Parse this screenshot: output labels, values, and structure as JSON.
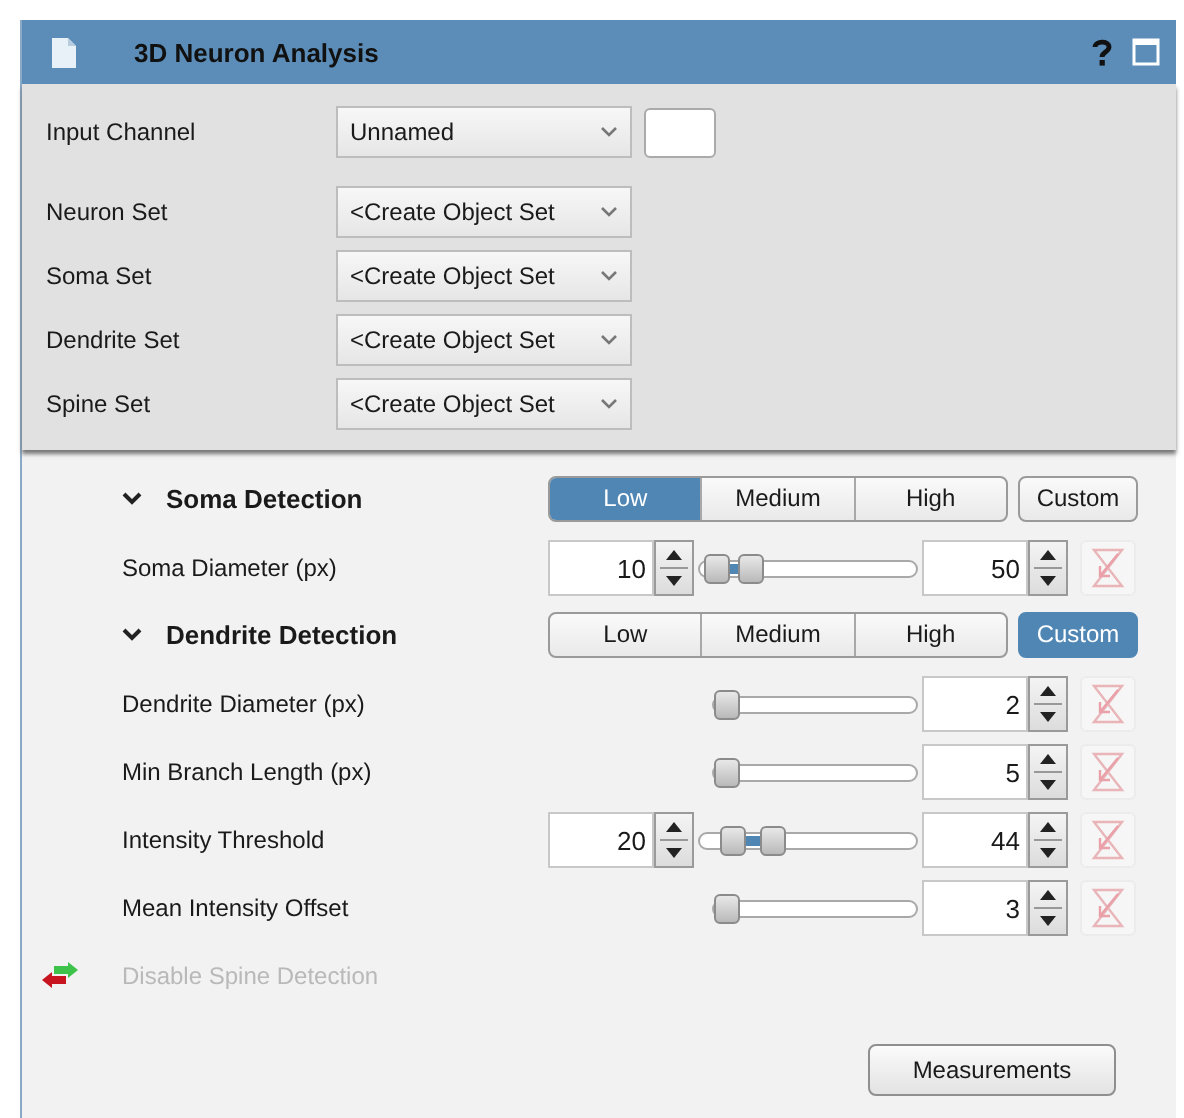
{
  "window": {
    "title": "3D Neuron Analysis"
  },
  "inputs": [
    {
      "label": "Input Channel",
      "value": "Unnamed",
      "kind": "channel"
    },
    {
      "label": "Neuron Set",
      "value": "<Create Object Set",
      "kind": "set"
    },
    {
      "label": "Soma Set",
      "value": "<Create Object Set",
      "kind": "set"
    },
    {
      "label": "Dendrite Set",
      "value": "<Create Object Set",
      "kind": "set"
    },
    {
      "label": "Spine Set",
      "value": "<Create Object Set",
      "kind": "set"
    }
  ],
  "sections": [
    {
      "title": "Soma Detection",
      "expanded": true,
      "presets": [
        {
          "label": "Low",
          "selected": true,
          "kind": "segment"
        },
        {
          "label": "Medium",
          "selected": false,
          "kind": "segment"
        },
        {
          "label": "High",
          "selected": false,
          "kind": "segment"
        },
        {
          "label": "Custom",
          "selected": false,
          "kind": "custom"
        }
      ],
      "params": [
        {
          "label": "Soma Diameter (px)",
          "kind": "range",
          "min_value": "10",
          "max_value": "50",
          "thumbs": [
            {
              "level": 0.02
            },
            {
              "level": 0.2
            }
          ]
        }
      ]
    },
    {
      "title": "Dendrite Detection",
      "expanded": true,
      "presets": [
        {
          "label": "Low",
          "selected": false,
          "kind": "segment"
        },
        {
          "label": "Medium",
          "selected": false,
          "kind": "segment"
        },
        {
          "label": "High",
          "selected": false,
          "kind": "segment"
        },
        {
          "label": "Custom",
          "selected": true,
          "kind": "custom"
        }
      ],
      "params": [
        {
          "label": "Dendrite Diameter (px)",
          "kind": "single",
          "value": "2",
          "level": 0
        },
        {
          "label": "Min Branch Length (px)",
          "kind": "single",
          "value": "5",
          "level": 0
        },
        {
          "label": "Intensity Threshold",
          "kind": "range",
          "min_value": "20",
          "max_value": "44",
          "thumbs": [
            {
              "level": 0.1
            },
            {
              "level": 0.32
            }
          ]
        },
        {
          "label": "Mean Intensity Offset",
          "kind": "single",
          "value": "3",
          "level": 0
        }
      ]
    }
  ],
  "spine_toggle": {
    "label": "Disable Spine Detection",
    "disabled": true
  },
  "buttons": [
    {
      "label": "Measurements"
    }
  ]
}
